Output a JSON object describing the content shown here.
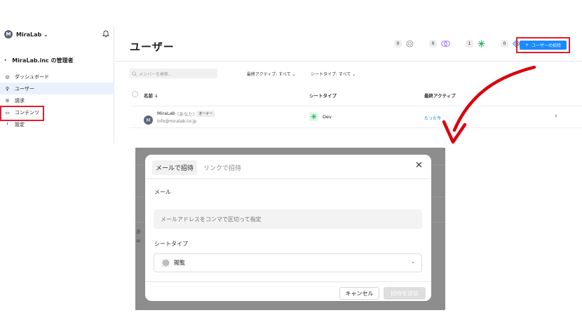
{
  "sidebar": {
    "workspace_initial": "M",
    "workspace_name": "MiraLab ⌄",
    "back_icon": "‹",
    "back_label": "MiraLab.inc の管理者",
    "items": [
      {
        "icon": "◎",
        "label": "ダッシュボード"
      },
      {
        "icon": "♀",
        "label": "ユーザー"
      },
      {
        "icon": "⑤",
        "label": "請求"
      },
      {
        "icon": "▭",
        "label": "コンテンツ"
      },
      {
        "icon": "⟊",
        "label": "設定"
      }
    ]
  },
  "header": {
    "title": "ユーザー",
    "counters": [
      "0",
      "0",
      "1",
      "0"
    ],
    "invite_label": "ユーザーの招待"
  },
  "toolbar": {
    "search_placeholder": "メンバーを検索...",
    "filter_last_active": "最終アクティブ: すべて ⌄",
    "filter_seat_type": "シートタイプ: すべて ⌄"
  },
  "table": {
    "col_name": "名前 ↓",
    "col_seat": "シートタイプ",
    "col_last": "最終アクティブ",
    "rows": [
      {
        "initial": "M",
        "name": "MiraLab",
        "you": "(あなた)",
        "role": "オーナー",
        "email": "info@miralab.co.jp",
        "seat": "Dev",
        "last_active": "たった今"
      }
    ]
  },
  "modal": {
    "tab_email": "メールで招待",
    "tab_link": "リンクで招待",
    "close": "✕",
    "email_label": "メール",
    "email_placeholder": "メールアドレスをコンマで区切って指定",
    "seat_label": "シートタイプ",
    "seat_value": "閲覧",
    "cancel": "キャンセル",
    "send": "招待を送信"
  },
  "background_fragments": [
    "あ",
    "ai"
  ],
  "colors": {
    "accent": "#1a8cff",
    "highlight": "#e11d2e",
    "dev_green": "#1fb45c"
  }
}
